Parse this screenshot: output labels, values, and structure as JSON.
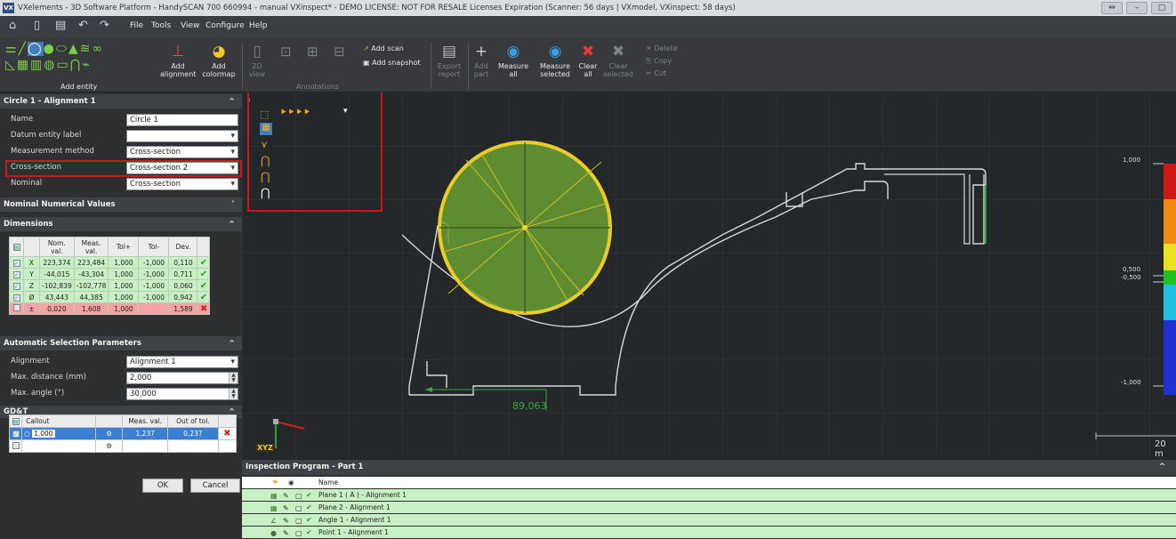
{
  "app": {
    "title": "VXelements - 3D Software Platform - HandySCAN 700 660994 - manual VXinspect* - DEMO LICENSE: NOT FOR RESALE Licenses Expiration (Scanner: 56 days | VXmodel, VXinspect: 58 days)",
    "icon_text": "VX"
  },
  "menu": {
    "items": [
      "File",
      "Tools",
      "View",
      "Configure",
      "Help"
    ]
  },
  "ribbon": {
    "add_entity": "Add entity",
    "add_alignment": "Add\nalignment",
    "add_colormap": "Add\ncolormap",
    "view_2d": "2D\nview",
    "annotations": "Annotations",
    "add_scan": "Add scan",
    "add_snapshot": "Add snapshot",
    "export_report": "Export\nreport",
    "add_part": "Add\npart",
    "measure_all": "Measure\nall",
    "measure_selected": "Measure\nselected",
    "clear_all": "Clear\nall",
    "clear_selected": "Clear\nselected",
    "delete": "Delete",
    "copy": "Copy",
    "cut": "Cut"
  },
  "panel": {
    "title": "Circle 1 - Alignment 1",
    "props": [
      {
        "label": "Name",
        "value": "Circle 1"
      },
      {
        "label": "Datum entity label",
        "value": ""
      },
      {
        "label": "Measurement method",
        "value": "Cross-section"
      },
      {
        "label": "Cross-section",
        "value": "Cross-section 2"
      },
      {
        "label": "Nominal",
        "value": "Cross-section"
      }
    ],
    "nominal_numerical_values": "Nominal Numerical Values",
    "dimensions": {
      "title": "Dimensions",
      "headers": [
        "Nom.\nval.",
        "Meas.\nval.",
        "Tol+",
        "Tol-",
        "Dev."
      ],
      "rows": [
        {
          "axis": "X",
          "nom": "223,374",
          "meas": "223,484",
          "tolp": "1,000",
          "tolm": "-1,000",
          "dev": "0,110"
        },
        {
          "axis": "Y",
          "nom": "-44,015",
          "meas": "-43,304",
          "tolp": "1,000",
          "tolm": "-1,000",
          "dev": "0,711"
        },
        {
          "axis": "Z",
          "nom": "-102,839",
          "meas": "-102,778",
          "tolp": "1,000",
          "tolm": "-1,000",
          "dev": "0,060"
        },
        {
          "axis": "Ø",
          "nom": "43,443",
          "meas": "44,385",
          "tolp": "1,000",
          "tolm": "-1,000",
          "dev": "0,942"
        },
        {
          "axis": "±",
          "nom": "0,020",
          "meas": "1,608",
          "tolp": "1,000",
          "tolm": "",
          "dev": "1,589"
        }
      ]
    },
    "auto_selection": {
      "title": "Automatic Selection Parameters",
      "alignment_label": "Alignment",
      "alignment_value": "Alignment 1",
      "max_distance_label": "Max. distance (mm)",
      "max_distance_value": "2,000",
      "max_angle_label": "Max. angle (°)",
      "max_angle_value": "30,000"
    },
    "gdt": {
      "title": "GD&T",
      "headers": [
        "Callout",
        "Meas. val.",
        "Out of tol."
      ],
      "row": {
        "callout": "1,000",
        "meas": "1,237",
        "out": "0,237"
      }
    },
    "ok": "OK",
    "cancel": "Cancel"
  },
  "viewport": {
    "dimension_value": "89,063",
    "scale_labels": [
      "1,000",
      "0,500",
      "-0,500",
      "-1,000"
    ],
    "scale_bar_label": "20 m",
    "axes_label": "XYZ"
  },
  "inspection": {
    "title": "Inspection Program - Part 1",
    "name_header": "Name",
    "rows": [
      "Plane 1 ( A ) - Alignment 1",
      "Plane 2 - Alignment 1",
      "Angle 1 - Alignment 1",
      "Point 1 - Alignment 1"
    ]
  }
}
